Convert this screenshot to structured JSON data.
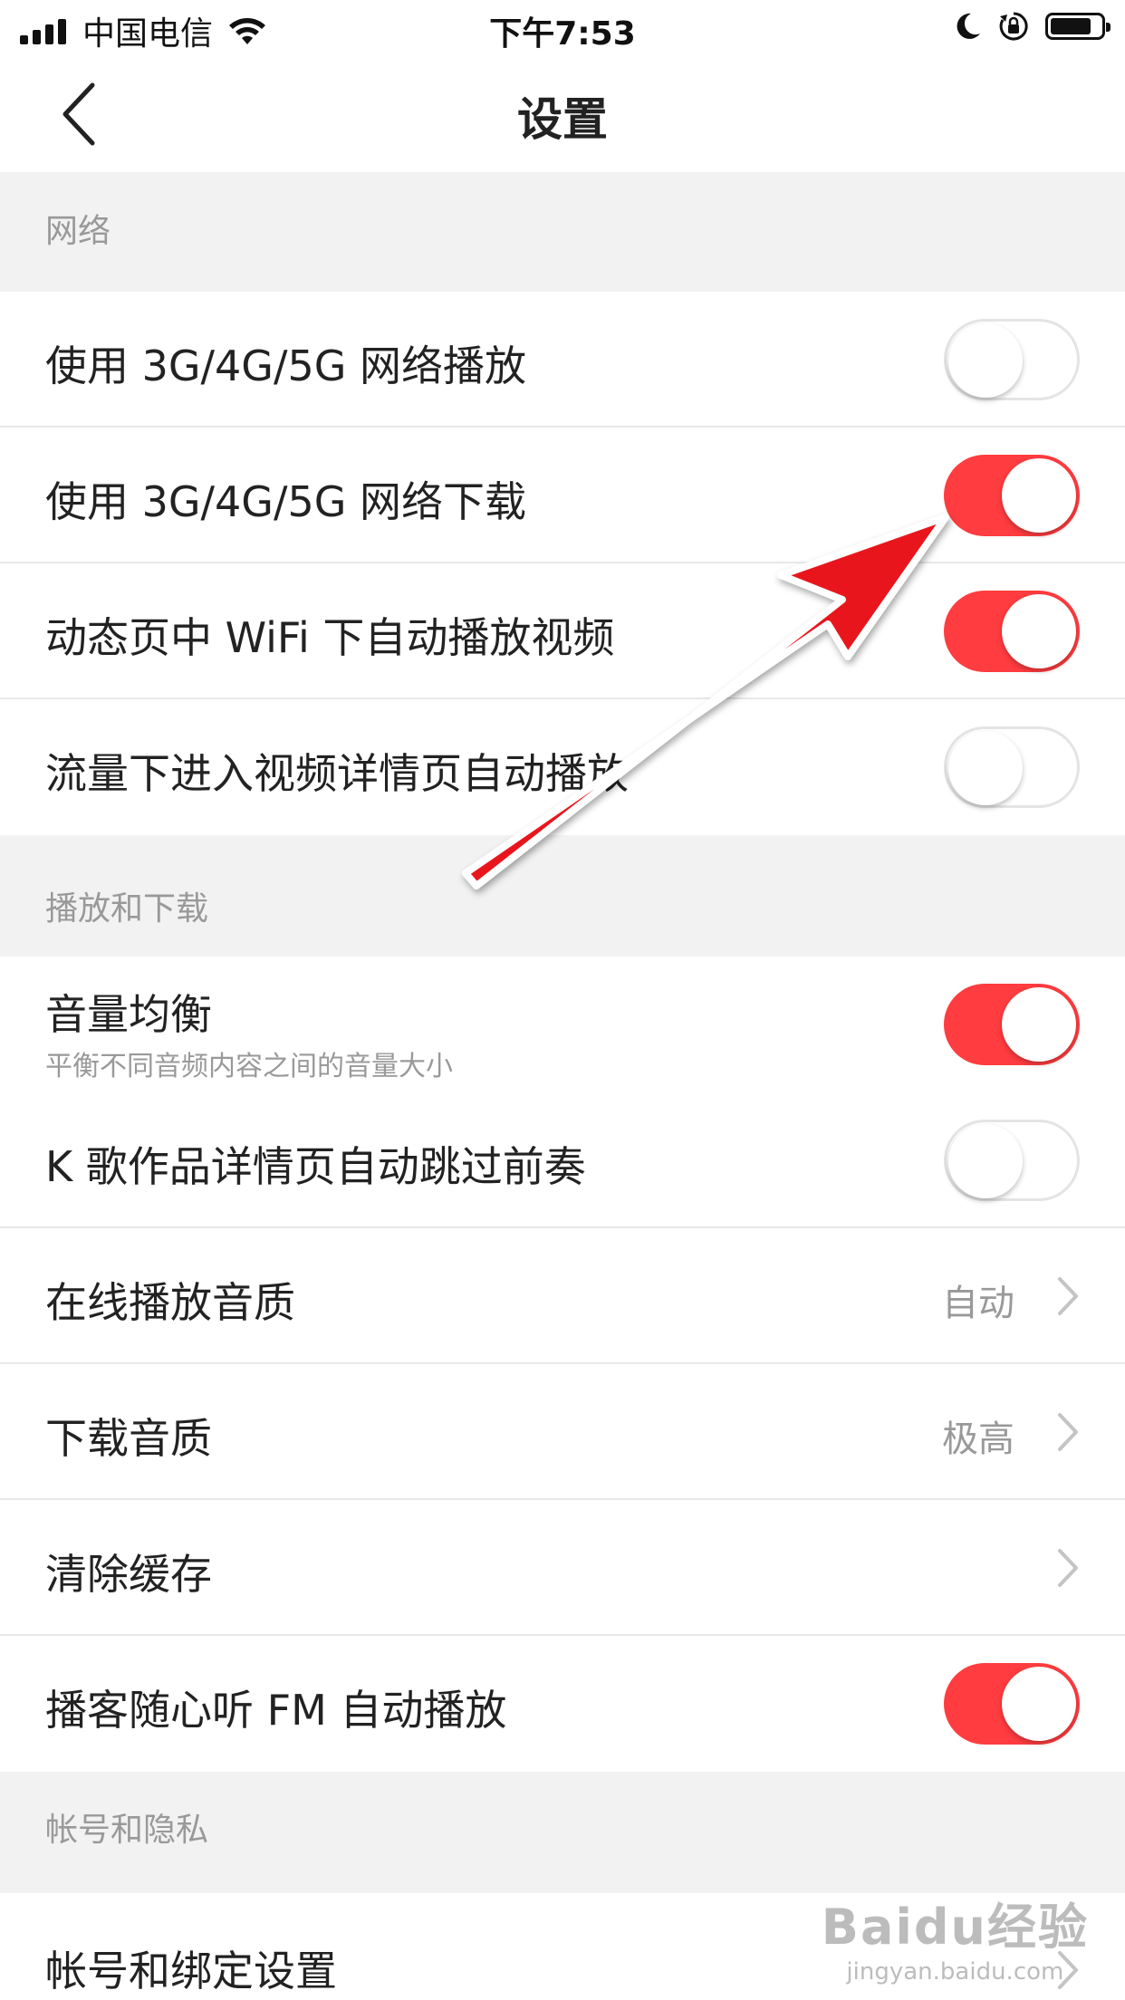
{
  "status_bar": {
    "carrier": "中国电信",
    "time": "下午7:53"
  },
  "nav": {
    "title": "设置"
  },
  "sections": {
    "network": "网络",
    "playback": "播放和下载",
    "account": "帐号和隐私"
  },
  "rows": {
    "use_3g_play": {
      "label": "使用 3G/4G/5G 网络播放",
      "toggle_on": false
    },
    "use_3g_download": {
      "label": "使用 3G/4G/5G 网络下载",
      "toggle_on": true
    },
    "wifi_autoplay": {
      "label": "动态页中 WiFi 下自动播放视频",
      "toggle_on": true
    },
    "data_autoplay": {
      "label": "流量下进入视频详情页自动播放",
      "toggle_on": false
    },
    "volume_balance": {
      "label": "音量均衡",
      "sublabel": "平衡不同音频内容之间的音量大小",
      "toggle_on": true
    },
    "skip_intro": {
      "label": "K 歌作品详情页自动跳过前奏",
      "toggle_on": false
    },
    "online_quality": {
      "label": "在线播放音质",
      "value": "自动"
    },
    "download_quality": {
      "label": "下载音质",
      "value": "极高"
    },
    "clear_cache": {
      "label": "清除缓存"
    },
    "fm_autoplay": {
      "label": "播客随心听 FM 自动播放",
      "toggle_on": true
    },
    "account_binding": {
      "label": "帐号和绑定设置"
    }
  },
  "watermark": {
    "logo": "Baidu经验",
    "url": "jingyan.baidu.com"
  },
  "colors": {
    "accent": "#ff3c3f",
    "annotation_arrow": "#e8141a",
    "background": "#f2f2f2"
  }
}
